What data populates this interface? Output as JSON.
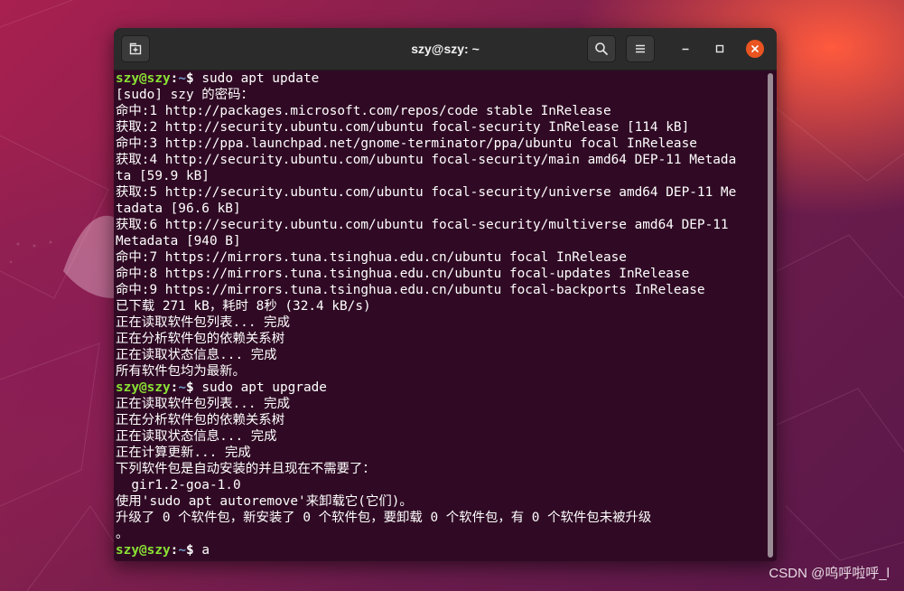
{
  "window": {
    "title": "szy@szy: ~"
  },
  "colors": {
    "terminal_bg": "#300a24",
    "prompt_user": "#8ae234",
    "prompt_path": "#729fcf",
    "close_button": "#e95420"
  },
  "icons": {
    "new_tab": "new-tab-icon",
    "search": "search-icon",
    "menu": "hamburger-menu-icon",
    "minimize": "minimize-icon",
    "maximize": "maximize-icon",
    "close": "close-icon"
  },
  "terminal": {
    "lines": [
      {
        "prompt": {
          "user": "szy@szy",
          "sep": ":",
          "path": "~",
          "sym": "$ "
        },
        "text": "sudo apt update"
      },
      {
        "text": "[sudo] szy 的密码："
      },
      {
        "text": "命中:1 http://packages.microsoft.com/repos/code stable InRelease"
      },
      {
        "text": "获取:2 http://security.ubuntu.com/ubuntu focal-security InRelease [114 kB]"
      },
      {
        "text": "命中:3 http://ppa.launchpad.net/gnome-terminator/ppa/ubuntu focal InRelease"
      },
      {
        "text": "获取:4 http://security.ubuntu.com/ubuntu focal-security/main amd64 DEP-11 Metada"
      },
      {
        "text": "ta [59.9 kB]"
      },
      {
        "text": "获取:5 http://security.ubuntu.com/ubuntu focal-security/universe amd64 DEP-11 Me"
      },
      {
        "text": "tadata [96.6 kB]"
      },
      {
        "text": "获取:6 http://security.ubuntu.com/ubuntu focal-security/multiverse amd64 DEP-11"
      },
      {
        "text": "Metadata [940 B]"
      },
      {
        "text": "命中:7 https://mirrors.tuna.tsinghua.edu.cn/ubuntu focal InRelease"
      },
      {
        "text": "命中:8 https://mirrors.tuna.tsinghua.edu.cn/ubuntu focal-updates InRelease"
      },
      {
        "text": "命中:9 https://mirrors.tuna.tsinghua.edu.cn/ubuntu focal-backports InRelease"
      },
      {
        "text": "已下载 271 kB，耗时 8秒 (32.4 kB/s)"
      },
      {
        "text": "正在读取软件包列表... 完成"
      },
      {
        "text": "正在分析软件包的依赖关系树"
      },
      {
        "text": "正在读取状态信息... 完成"
      },
      {
        "text": "所有软件包均为最新。"
      },
      {
        "prompt": {
          "user": "szy@szy",
          "sep": ":",
          "path": "~",
          "sym": "$ "
        },
        "text": "sudo apt upgrade"
      },
      {
        "text": "正在读取软件包列表... 完成"
      },
      {
        "text": "正在分析软件包的依赖关系树"
      },
      {
        "text": "正在读取状态信息... 完成"
      },
      {
        "text": "正在计算更新... 完成"
      },
      {
        "text": "下列软件包是自动安装的并且现在不需要了："
      },
      {
        "text": "  gir1.2-goa-1.0"
      },
      {
        "text": "使用'sudo apt autoremove'来卸载它(它们)。"
      },
      {
        "text": "升级了 0 个软件包，新安装了 0 个软件包，要卸载 0 个软件包，有 0 个软件包未被升级"
      },
      {
        "text": "。"
      },
      {
        "prompt": {
          "user": "szy@szy",
          "sep": ":",
          "path": "~",
          "sym": "$ "
        },
        "text": "a"
      }
    ]
  },
  "watermark": "CSDN @呜呼啦呼_l"
}
